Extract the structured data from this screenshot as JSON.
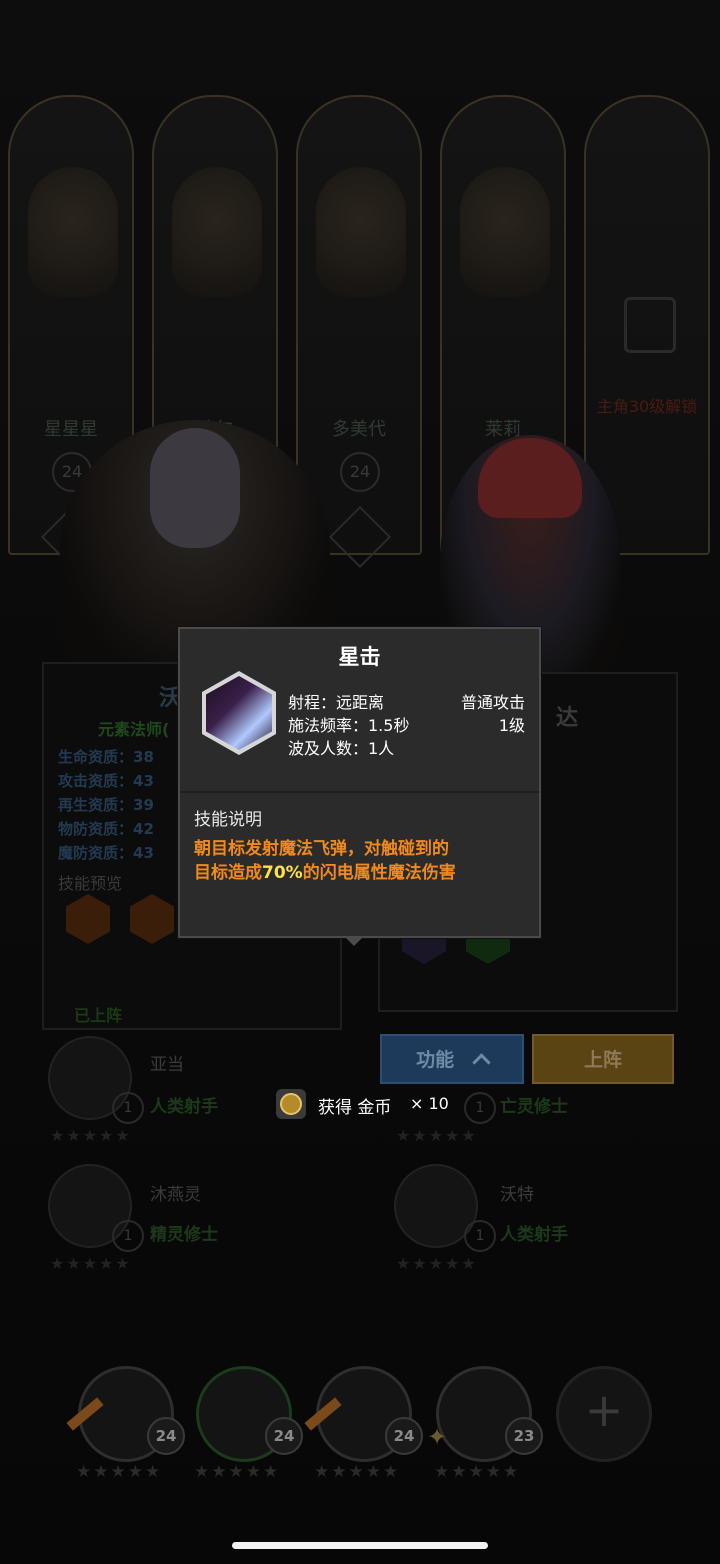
{
  "top_roster": [
    {
      "name": "星星星",
      "level": "24"
    },
    {
      "name": "波尔",
      "level": ""
    },
    {
      "name": "多美代",
      "level": "24"
    },
    {
      "name": "莱莉",
      "level": ""
    },
    {
      "name": "主角30级解锁",
      "level": ""
    }
  ],
  "left_panel": {
    "title_fragment": "沃",
    "class_label": "元素法师(",
    "stats": [
      "生命资质：38",
      "攻击资质：43",
      "再生资质：39",
      "物防资质：42",
      "魔防资质：43"
    ],
    "skill_preview_label": "技能预览",
    "status": "已上阵"
  },
  "right_panel": {
    "title_fragment": "达"
  },
  "popup": {
    "title": "星击",
    "range": "射程：远距离",
    "attack_type": "普通攻击",
    "cast_rate": "施法频率：1.5秒",
    "skill_level": "1级",
    "targets": "波及人数：1人",
    "desc_header": "技能说明",
    "desc_line1": "朝目标发射魔法飞弹，对触碰到的",
    "desc_line2_a": "目标造成",
    "desc_line2_b": "70%",
    "desc_line2_c": "的闪电属性魔法伤害"
  },
  "buttons": {
    "function": "功能",
    "deploy": "上阵"
  },
  "reward_toast": {
    "text": "获得 金币",
    "count": "× 10"
  },
  "roster_list": [
    {
      "name": "亚当",
      "level": "1",
      "class": "人类射手",
      "stars": "★★★★★"
    },
    {
      "name": "",
      "level": "1",
      "class": "亡灵修士",
      "stars": "★★★★★"
    },
    {
      "name": "沐燕灵",
      "level": "1",
      "class": "精灵修士",
      "stars": "★★★★★"
    },
    {
      "name": "沃特",
      "level": "1",
      "class": "人类射手",
      "stars": "★★★★★"
    }
  ],
  "team": [
    {
      "level": "24",
      "stars": "★★★★★"
    },
    {
      "level": "24",
      "stars": "★★★★★"
    },
    {
      "level": "24",
      "stars": "★★★★★"
    },
    {
      "level": "23",
      "stars": "★★★★★"
    }
  ],
  "add_symbol": "+",
  "colors": {
    "popup_bg": "#2b2b2b",
    "desc_orange": "#f08a1e",
    "desc_yellow": "#ffe14a",
    "function_btn": "#1e3a5a",
    "deploy_btn": "#5a4414"
  }
}
